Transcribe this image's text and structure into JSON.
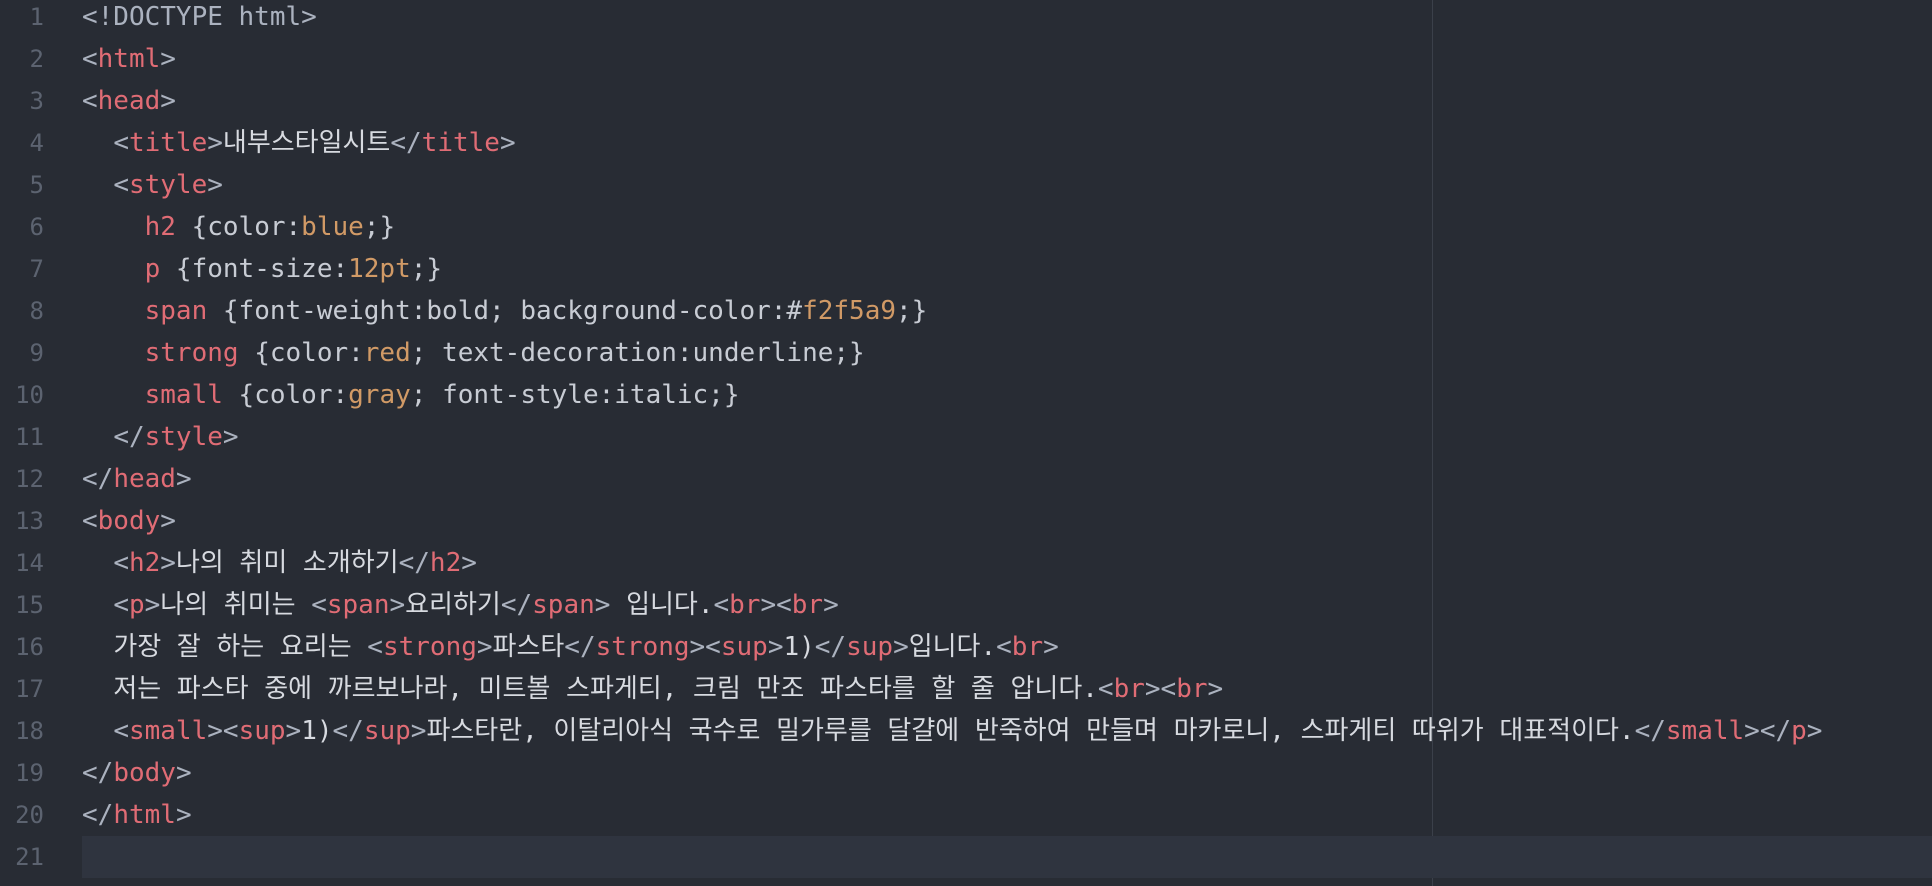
{
  "editor": {
    "colors": {
      "background": "#282c34",
      "tag": "#e06c75",
      "value": "#d19a66",
      "text": "#d7dae0",
      "gutter": "#5c6370"
    },
    "lines": [
      {
        "n": "1",
        "indent": "",
        "tokens": [
          [
            "punc",
            "<!DOCTYPE html>"
          ]
        ]
      },
      {
        "n": "2",
        "indent": "",
        "tokens": [
          [
            "punc",
            "<"
          ],
          [
            "tag",
            "html"
          ],
          [
            "punc",
            ">"
          ]
        ]
      },
      {
        "n": "3",
        "indent": "",
        "tokens": [
          [
            "punc",
            "<"
          ],
          [
            "tag",
            "head"
          ],
          [
            "punc",
            ">"
          ]
        ]
      },
      {
        "n": "4",
        "indent": "  ",
        "tokens": [
          [
            "punc",
            "<"
          ],
          [
            "tag",
            "title"
          ],
          [
            "punc",
            ">"
          ],
          [
            "text",
            "내부스타일시트"
          ],
          [
            "punc",
            "</"
          ],
          [
            "tag",
            "title"
          ],
          [
            "punc",
            ">"
          ]
        ]
      },
      {
        "n": "5",
        "indent": "  ",
        "tokens": [
          [
            "punc",
            "<"
          ],
          [
            "tag",
            "style"
          ],
          [
            "punc",
            ">"
          ]
        ]
      },
      {
        "n": "6",
        "indent": "    ",
        "tokens": [
          [
            "tag",
            "h2"
          ],
          [
            "prop",
            " {color:"
          ],
          [
            "val",
            "blue"
          ],
          [
            "prop",
            ";}"
          ]
        ]
      },
      {
        "n": "7",
        "indent": "    ",
        "tokens": [
          [
            "tag",
            "p"
          ],
          [
            "prop",
            " {font-size:"
          ],
          [
            "val",
            "12pt"
          ],
          [
            "prop",
            ";}"
          ]
        ]
      },
      {
        "n": "8",
        "indent": "    ",
        "tokens": [
          [
            "tag",
            "span"
          ],
          [
            "prop",
            " {font-weight:bold; background-color:#"
          ],
          [
            "val",
            "f2f5a9"
          ],
          [
            "prop",
            ";}"
          ]
        ]
      },
      {
        "n": "9",
        "indent": "    ",
        "tokens": [
          [
            "tag",
            "strong"
          ],
          [
            "prop",
            " {color:"
          ],
          [
            "val",
            "red"
          ],
          [
            "prop",
            "; text-decoration:underline;}"
          ]
        ]
      },
      {
        "n": "10",
        "indent": "    ",
        "tokens": [
          [
            "tag",
            "small"
          ],
          [
            "prop",
            " {color:"
          ],
          [
            "val",
            "gray"
          ],
          [
            "prop",
            "; font-style:italic;}"
          ]
        ]
      },
      {
        "n": "11",
        "indent": "  ",
        "tokens": [
          [
            "punc",
            "</"
          ],
          [
            "tag",
            "style"
          ],
          [
            "punc",
            ">"
          ]
        ]
      },
      {
        "n": "12",
        "indent": "",
        "tokens": [
          [
            "punc",
            "</"
          ],
          [
            "tag",
            "head"
          ],
          [
            "punc",
            ">"
          ]
        ]
      },
      {
        "n": "13",
        "indent": "",
        "tokens": [
          [
            "punc",
            "<"
          ],
          [
            "tag",
            "body"
          ],
          [
            "punc",
            ">"
          ]
        ]
      },
      {
        "n": "14",
        "indent": "  ",
        "tokens": [
          [
            "punc",
            "<"
          ],
          [
            "tag",
            "h2"
          ],
          [
            "punc",
            ">"
          ],
          [
            "text",
            "나의 취미 소개하기"
          ],
          [
            "punc",
            "</"
          ],
          [
            "tag",
            "h2"
          ],
          [
            "punc",
            ">"
          ]
        ]
      },
      {
        "n": "15",
        "indent": "  ",
        "tokens": [
          [
            "punc",
            "<"
          ],
          [
            "tag",
            "p"
          ],
          [
            "punc",
            ">"
          ],
          [
            "text",
            "나의 취미는 "
          ],
          [
            "punc",
            "<"
          ],
          [
            "tag",
            "span"
          ],
          [
            "punc",
            ">"
          ],
          [
            "text",
            "요리하기"
          ],
          [
            "punc",
            "</"
          ],
          [
            "tag",
            "span"
          ],
          [
            "punc",
            ">"
          ],
          [
            "text",
            " 입니다."
          ],
          [
            "punc",
            "<"
          ],
          [
            "tag",
            "br"
          ],
          [
            "punc",
            "><"
          ],
          [
            "tag",
            "br"
          ],
          [
            "punc",
            ">"
          ]
        ]
      },
      {
        "n": "16",
        "indent": "  ",
        "tokens": [
          [
            "text",
            "가장 잘 하는 요리는 "
          ],
          [
            "punc",
            "<"
          ],
          [
            "tag",
            "strong"
          ],
          [
            "punc",
            ">"
          ],
          [
            "text",
            "파스타"
          ],
          [
            "punc",
            "</"
          ],
          [
            "tag",
            "strong"
          ],
          [
            "punc",
            "><"
          ],
          [
            "tag",
            "sup"
          ],
          [
            "punc",
            ">"
          ],
          [
            "text",
            "1)"
          ],
          [
            "punc",
            "</"
          ],
          [
            "tag",
            "sup"
          ],
          [
            "punc",
            ">"
          ],
          [
            "text",
            "입니다."
          ],
          [
            "punc",
            "<"
          ],
          [
            "tag",
            "br"
          ],
          [
            "punc",
            ">"
          ]
        ]
      },
      {
        "n": "17",
        "indent": "  ",
        "tokens": [
          [
            "text",
            "저는 파스타 중에 까르보나라, 미트볼 스파게티, 크림 만조 파스타를 할 줄 압니다."
          ],
          [
            "punc",
            "<"
          ],
          [
            "tag",
            "br"
          ],
          [
            "punc",
            "><"
          ],
          [
            "tag",
            "br"
          ],
          [
            "punc",
            ">"
          ]
        ]
      },
      {
        "n": "18",
        "indent": "  ",
        "tokens": [
          [
            "punc",
            "<"
          ],
          [
            "tag",
            "small"
          ],
          [
            "punc",
            "><"
          ],
          [
            "tag",
            "sup"
          ],
          [
            "punc",
            ">"
          ],
          [
            "text",
            "1)"
          ],
          [
            "punc",
            "</"
          ],
          [
            "tag",
            "sup"
          ],
          [
            "punc",
            ">"
          ],
          [
            "text",
            "파스타란, 이탈리아식 국수로 밀가루를 달걀에 반죽하여 만들며 마카로니, 스파게티 따위가 대표적이다."
          ],
          [
            "punc",
            "</"
          ],
          [
            "tag",
            "small"
          ],
          [
            "punc",
            "></"
          ],
          [
            "tag",
            "p"
          ],
          [
            "punc",
            ">"
          ]
        ]
      },
      {
        "n": "19",
        "indent": "",
        "tokens": [
          [
            "punc",
            "</"
          ],
          [
            "tag",
            "body"
          ],
          [
            "punc",
            ">"
          ]
        ]
      },
      {
        "n": "20",
        "indent": "",
        "tokens": [
          [
            "punc",
            "</"
          ],
          [
            "tag",
            "html"
          ],
          [
            "punc",
            ">"
          ]
        ]
      },
      {
        "n": "21",
        "indent": "",
        "tokens": []
      }
    ]
  }
}
